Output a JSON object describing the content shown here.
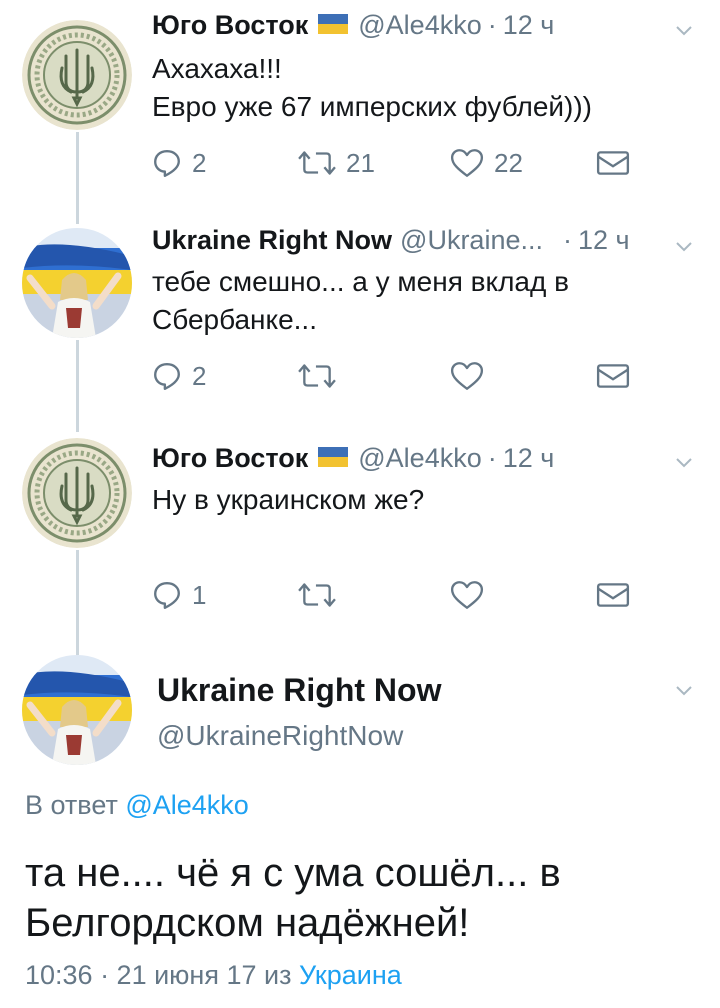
{
  "tweets": [
    {
      "author": "Юго Восток",
      "has_flag": true,
      "handle": "@Ale4kko",
      "separator": "·",
      "time": "12 ч",
      "text_lines": [
        "Ахахаха!!!",
        "Евро уже 67 имперских фублей)))"
      ],
      "replies": "2",
      "retweets": "21",
      "likes": "22",
      "avatar": "trident-emblem"
    },
    {
      "author": "Ukraine Right Now",
      "has_flag": false,
      "handle": "@Ukraine...",
      "separator": "·",
      "time": "12 ч",
      "text_lines": [
        "тебе смешно... а у меня вклад в",
        "Сбербанке..."
      ],
      "replies": "2",
      "retweets": "",
      "likes": "",
      "avatar": "woman-with-flag"
    },
    {
      "author": "Юго Восток",
      "has_flag": true,
      "handle": "@Ale4kko",
      "separator": "·",
      "time": "12 ч",
      "text_lines": [
        "Ну в украинском же?"
      ],
      "replies": "1",
      "retweets": "",
      "likes": "",
      "avatar": "trident-emblem"
    }
  ],
  "main": {
    "author": "Ukraine Right Now",
    "handle": "@UkraineRightNow",
    "reply_prefix": "В ответ",
    "reply_link": "@Ale4kko",
    "text_lines": [
      "та не.... чё я с ума сошёл... в",
      "Белгордском надёжней!"
    ],
    "timestamp": "10:36 · 21 июня 17 из",
    "location": "Украина",
    "avatar": "woman-with-flag"
  },
  "colors": {
    "accent": "#1da1f2",
    "secondary_text": "#657786",
    "thread_line": "#ccd6dd",
    "flag_blue": "#3d6fb6",
    "flag_yellow": "#f2c230"
  },
  "icons": [
    "reply-icon",
    "retweet-icon",
    "like-icon",
    "direct-message-icon",
    "chevron-down-icon"
  ]
}
